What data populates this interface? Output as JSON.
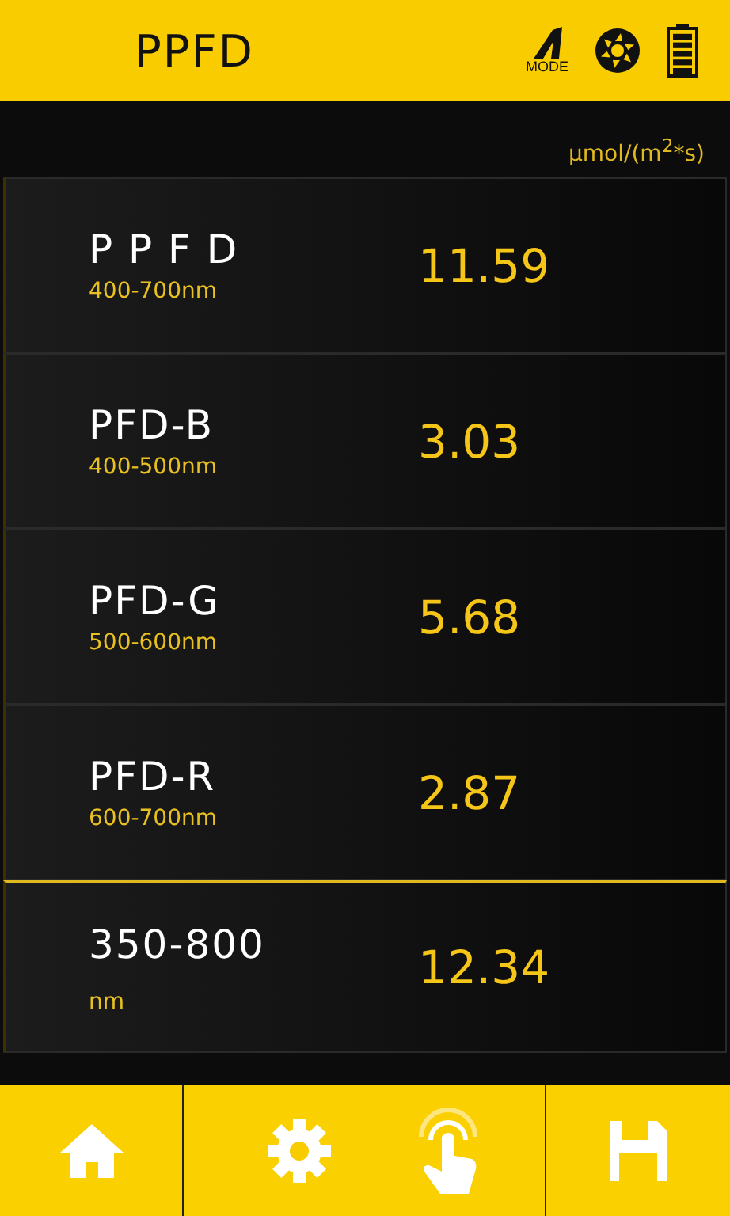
{
  "header": {
    "title": "PPFD",
    "mode_label": "MODE"
  },
  "unit": "μmol/(m$^{2}$*s)",
  "rows": [
    {
      "name": "P P F D",
      "range": "400-700nm",
      "value": "11.59"
    },
    {
      "name": "PFD-B",
      "range": "400-500nm",
      "value": "3.03"
    },
    {
      "name": "PFD-G",
      "range": "500-600nm",
      "value": "5.68"
    },
    {
      "name": "PFD-R",
      "range": "600-700nm",
      "value": "2.87"
    },
    {
      "name": "350-800",
      "range": "nm",
      "value": "12.34"
    }
  ]
}
